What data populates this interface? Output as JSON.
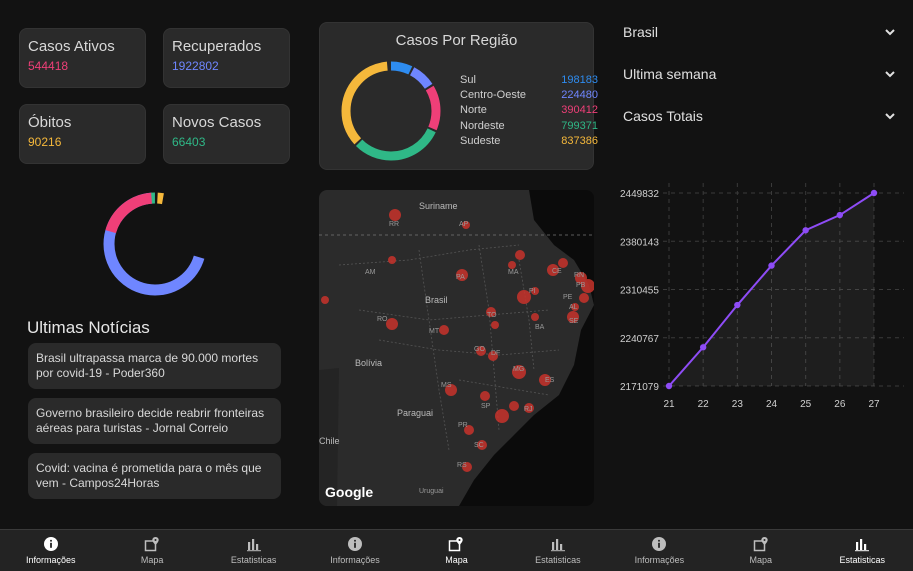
{
  "stats": {
    "ativos": {
      "label": "Casos Ativos",
      "value": "544418",
      "color": "#ef3f78"
    },
    "recuperados": {
      "label": "Recuperados",
      "value": "1922802",
      "color": "#6f86ff"
    },
    "obitos": {
      "label": "Óbitos",
      "value": "90216",
      "color": "#f5b83b"
    },
    "novos": {
      "label": "Novos Casos",
      "value": "66403",
      "color": "#2fb887"
    }
  },
  "status_donut": {
    "colors": [
      "#6f86ff",
      "#ef3f78",
      "#2fb887",
      "#f5b83b"
    ]
  },
  "regiao": {
    "title": "Casos Por Região",
    "items": [
      {
        "name": "Sul",
        "value": "198183",
        "color": "#2e8cf0"
      },
      {
        "name": "Centro-Oeste",
        "value": "224480",
        "color": "#6f86ff"
      },
      {
        "name": "Norte",
        "value": "390412",
        "color": "#ef3f78"
      },
      {
        "name": "Nordeste",
        "value": "799371",
        "color": "#2fb887"
      },
      {
        "name": "Sudeste",
        "value": "837386",
        "color": "#f5b83b"
      }
    ]
  },
  "filters": {
    "location": "Brasil",
    "period": "Ultima semana",
    "metric": "Casos Totais"
  },
  "news": {
    "header": "Ultimas Notícias",
    "items": [
      "Brasil ultrapassa marca de 90.000 mortes por covid-19 - Poder360",
      "Governo brasileiro decide reabrir fronteiras aéreas para turistas - Jornal Correio",
      "Covid: vacina é prometida para o mês que vem - Campos24Horas"
    ]
  },
  "map": {
    "labels": {
      "suriname": "Suriname",
      "rr": "RR",
      "ap": "AP",
      "am": "AM",
      "pa": "PA",
      "ma": "MA",
      "ce": "CE",
      "rn": "RN",
      "pb": "PB",
      "pe": "PE",
      "pi": "PI",
      "al": "AL",
      "se": "SE",
      "brasil": "Brasil",
      "ro": "RO",
      "mt": "MT",
      "to": "TO",
      "ba": "BA",
      "go": "GO",
      "df": "DF",
      "mg": "MG",
      "es": "ES",
      "bolivia": "Bolívia",
      "ms": "MS",
      "sp": "SP",
      "rj": "RJ",
      "paraguai": "Paraguai",
      "pr": "PR",
      "sc": "SC",
      "chile": "Chile",
      "rs": "RS",
      "uruguai": "Uruguai"
    },
    "google": "Google"
  },
  "chart_data": {
    "type": "line",
    "x": [
      21,
      22,
      23,
      24,
      25,
      26,
      27
    ],
    "values": [
      2171079,
      2227000,
      2288000,
      2345000,
      2396000,
      2418000,
      2449832
    ],
    "y_ticks": [
      "2449832",
      "2380143",
      "2310455",
      "2240767",
      "2171079"
    ],
    "ylim": [
      2171079,
      2449832
    ],
    "grid": true,
    "color": "#8e4cf6"
  },
  "nav": [
    {
      "label": "Informações",
      "icon": "info-icon",
      "active": true
    },
    {
      "label": "Mapa",
      "icon": "map-icon",
      "active": false
    },
    {
      "label": "Estatisticas",
      "icon": "bar-chart-icon",
      "active": false
    },
    {
      "label": "Informações",
      "icon": "info-icon",
      "active": false
    },
    {
      "label": "Mapa",
      "icon": "map-icon",
      "active": true
    },
    {
      "label": "Estatisticas",
      "icon": "bar-chart-icon",
      "active": false
    },
    {
      "label": "Informações",
      "icon": "info-icon",
      "active": false
    },
    {
      "label": "Mapa",
      "icon": "map-icon",
      "active": false
    },
    {
      "label": "Estatisticas",
      "icon": "bar-chart-icon",
      "active": true
    }
  ]
}
